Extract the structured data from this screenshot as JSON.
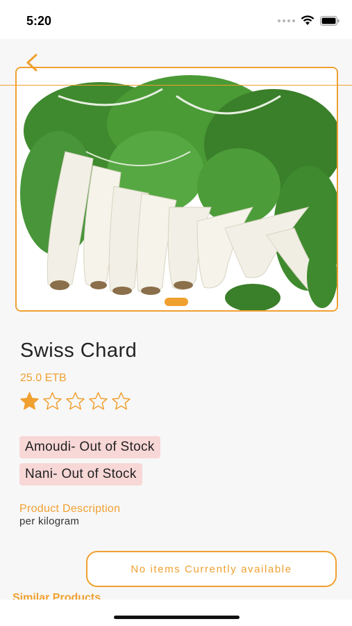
{
  "status_bar": {
    "time": "5:20"
  },
  "product": {
    "name": "Swiss Chard",
    "price": "25.0 ETB",
    "rating": 1,
    "rating_max": 5,
    "image_page": 1,
    "stock": [
      {
        "label": "Amoudi- Out of Stock"
      },
      {
        "label": "Nani- Out of Stock"
      }
    ],
    "description_heading": "Product Description",
    "description": "per kilogram"
  },
  "similar_heading": "Similar Products",
  "toast": {
    "message": "No items Currently available"
  },
  "colors": {
    "accent": "#f0a030",
    "badge_bg": "#f8d7d7",
    "leaf_green": "#3f8a2e",
    "stalk_white": "#f2f0e6"
  },
  "icons": {
    "back": "chevron-left-icon",
    "star_filled": "star-filled-icon",
    "star_empty": "star-outline-icon"
  }
}
